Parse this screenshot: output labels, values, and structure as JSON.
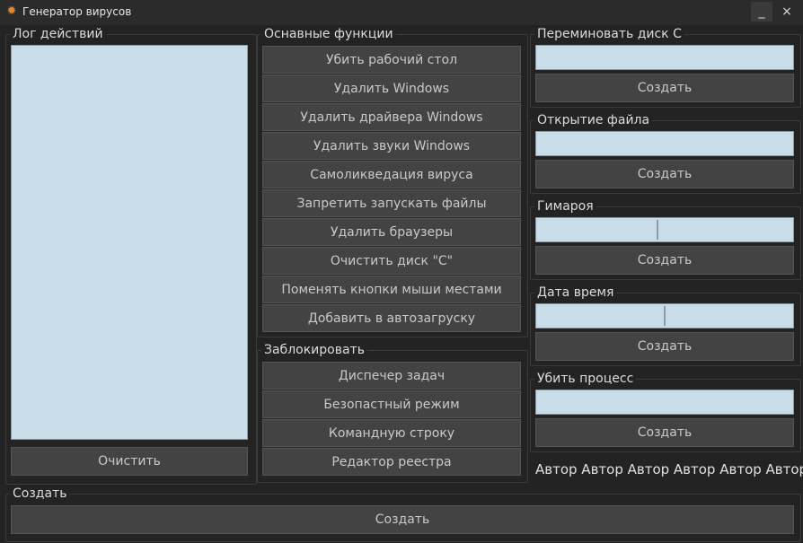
{
  "window": {
    "title": "Генератор вирусов",
    "minimize_glyph": "_",
    "close_glyph": "×"
  },
  "log": {
    "title": "Лог действий",
    "clear_label": "Очистить"
  },
  "main_functions": {
    "title": "Оснавные функции",
    "buttons": [
      "Убить рабочий стол",
      "Удалить Windows",
      "Удалить драйвера Windows",
      "Удалить звуки Windows",
      "Самоликведация вируса",
      "Запретить запускать файлы",
      "Удалить браузеры",
      "Очистить диск \"C\"",
      "Поменять кнопки мыши местами",
      "Добавить в автозагруску"
    ]
  },
  "block": {
    "title": "Заблокировать",
    "buttons": [
      "Диспечер задач",
      "Безопастный режим",
      "Командную строку",
      "Редактор реестра"
    ]
  },
  "right_panels": {
    "rename_disk": {
      "title": "Переминовать диск C",
      "button": "Создать",
      "input_value": ""
    },
    "open_file": {
      "title": "Открытие файла",
      "button": "Создать",
      "input_value": ""
    },
    "gimaroya": {
      "title": "Гимароя",
      "button": "Создать"
    },
    "date_time": {
      "title": "Дата время",
      "button": "Создать"
    },
    "kill_process": {
      "title": "Убить процесс",
      "button": "Создать",
      "input_value": ""
    }
  },
  "authors": "Автор Автор Автор Автор Автор Автор",
  "create": {
    "title": "Создать",
    "button": "Создать"
  },
  "colors": {
    "background": "#232323",
    "button": "#434343",
    "input": "#c9dde8",
    "accent_icon": "#e8842a"
  }
}
